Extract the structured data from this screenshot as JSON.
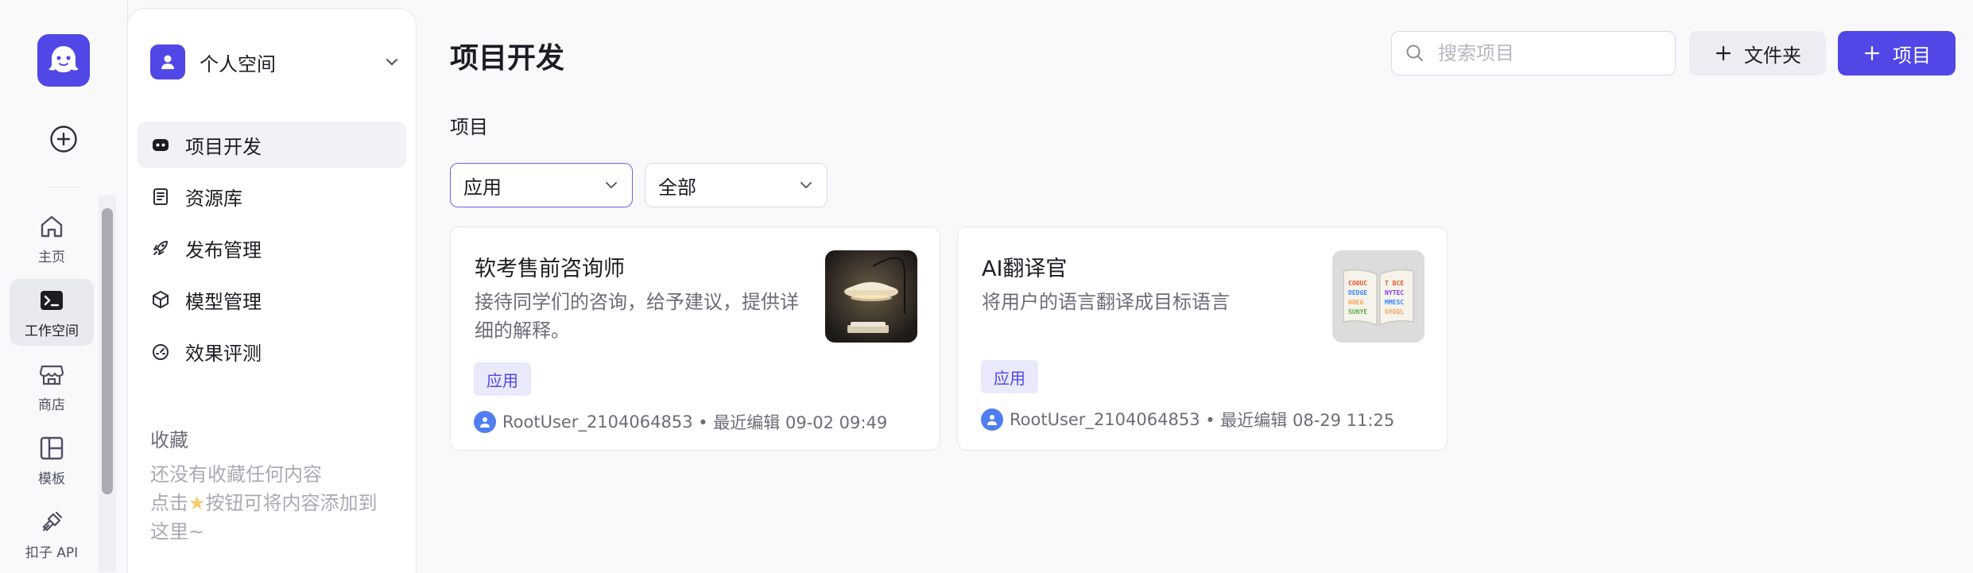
{
  "rail": {
    "items": [
      {
        "label": "主页",
        "icon": "home-icon"
      },
      {
        "label": "工作空间",
        "icon": "terminal-icon"
      },
      {
        "label": "商店",
        "icon": "store-icon"
      },
      {
        "label": "模板",
        "icon": "layout-icon"
      },
      {
        "label": "扣子 API",
        "icon": "plug-icon"
      }
    ],
    "active_index": 1
  },
  "sidebar": {
    "workspace_name": "个人空间",
    "nav": [
      {
        "label": "项目开发",
        "icon": "bot-icon"
      },
      {
        "label": "资源库",
        "icon": "library-icon"
      },
      {
        "label": "发布管理",
        "icon": "rocket-icon"
      },
      {
        "label": "模型管理",
        "icon": "cube-icon"
      },
      {
        "label": "效果评测",
        "icon": "gauge-icon"
      }
    ],
    "favorites_title": "收藏",
    "favorites_empty_line1": "还没有收藏任何内容",
    "favorites_empty_line2a": "点击",
    "favorites_empty_line2b": "按钮可将内容添加到",
    "favorites_empty_line3": "这里~"
  },
  "header": {
    "title": "项目开发",
    "search_placeholder": "搜索项目",
    "folder_button": "文件夹",
    "project_button": "项目"
  },
  "main": {
    "section_label": "项目",
    "type_select": "应用",
    "scope_select": "全部",
    "cards": [
      {
        "name": "软考售前咨询师",
        "desc": "接待同学们的咨询，给予建议，提供详细的解释。",
        "tag": "应用",
        "user": "RootUser_2104064853",
        "edited": "• 最近编辑 09-02 09:49"
      },
      {
        "name": "AI翻译官",
        "desc": "将用户的语言翻译成目标语言",
        "tag": "应用",
        "user": "RootUser_2104064853",
        "edited": "• 最近编辑 08-29 11:25"
      }
    ]
  },
  "colors": {
    "brand": "#5146e6",
    "avatar_blue": "#4f7ef0",
    "tag_bg": "#e9e9fb"
  }
}
